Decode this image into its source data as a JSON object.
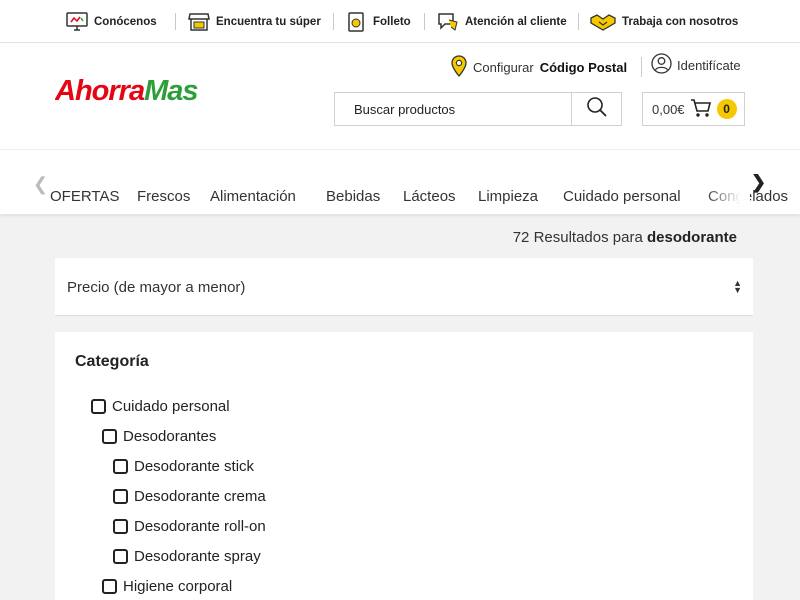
{
  "topbar": {
    "items": [
      {
        "label": "Conócenos",
        "icon": "monitor-icon"
      },
      {
        "label": "Encuentra tu súper",
        "icon": "store-icon"
      },
      {
        "label": "Folleto",
        "icon": "leaflet-icon"
      },
      {
        "label": "Atención al cliente",
        "icon": "chat-icon"
      },
      {
        "label": "Trabaja con nosotros",
        "icon": "handshake-icon"
      }
    ]
  },
  "header": {
    "logo_text": "AhorraMas",
    "postal_prefix": "Configurar",
    "postal_bold": "Código Postal",
    "login_label": "Identifícate",
    "search_placeholder": "Buscar productos",
    "cart_total": "0,00€",
    "cart_count": "0"
  },
  "catnav": {
    "items": [
      "OFERTAS",
      "Frescos",
      "Alimentación",
      "Bebidas",
      "Lácteos",
      "Limpieza",
      "Cuidado personal",
      "Congelados"
    ]
  },
  "results": {
    "count_text": "72 Resultados para",
    "query": "desodorante"
  },
  "sort": {
    "selected": "Precio (de mayor a menor)"
  },
  "filter": {
    "title": "Categoría",
    "options": [
      {
        "label": "Cuidado personal",
        "level": 0
      },
      {
        "label": "Desodorantes",
        "level": 1
      },
      {
        "label": "Desodorante stick",
        "level": 2
      },
      {
        "label": "Desodorante crema",
        "level": 2
      },
      {
        "label": "Desodorante roll-on",
        "level": 2
      },
      {
        "label": "Desodorante spray",
        "level": 2
      },
      {
        "label": "Higiene corporal",
        "level": 1
      }
    ]
  },
  "colors": {
    "brand_red": "#e30613",
    "brand_green": "#2e9e3a",
    "badge_yellow": "#f5c800"
  }
}
